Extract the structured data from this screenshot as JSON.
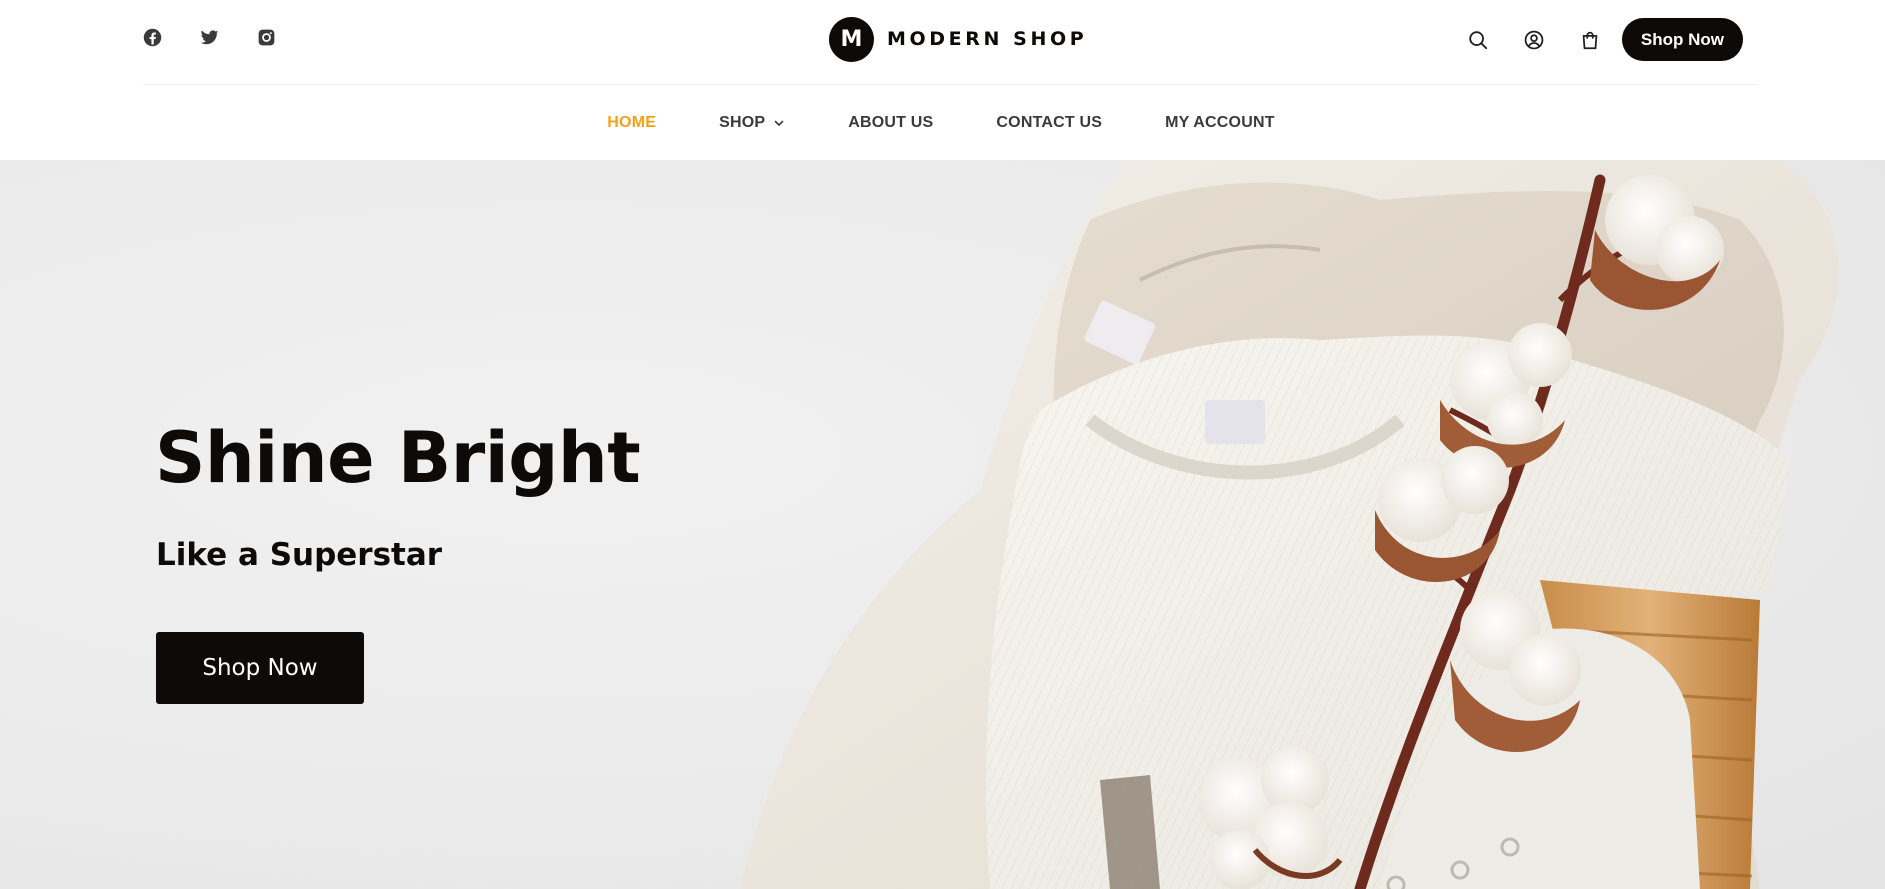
{
  "header": {
    "social_icons": [
      "facebook-icon",
      "twitter-icon",
      "instagram-icon"
    ],
    "brand": {
      "mark": "M",
      "name": "MODERN SHOP"
    },
    "tool_icons": [
      "search-icon",
      "account-icon",
      "cart-icon"
    ],
    "cta_label": "Shop Now"
  },
  "nav": {
    "items": [
      {
        "label": "HOME",
        "active": true
      },
      {
        "label": "SHOP",
        "has_dropdown": true
      },
      {
        "label": "ABOUT US"
      },
      {
        "label": "CONTACT US"
      },
      {
        "label": "MY ACCOUNT"
      }
    ]
  },
  "hero": {
    "title": "Shine Bright",
    "subtitle": "Like a Superstar",
    "button_label": "Shop Now"
  },
  "colors": {
    "primary": "#0d0a08",
    "accent": "#f4a11a",
    "nav_text": "#3a3a3a",
    "hero_background": "#ebebeb"
  }
}
